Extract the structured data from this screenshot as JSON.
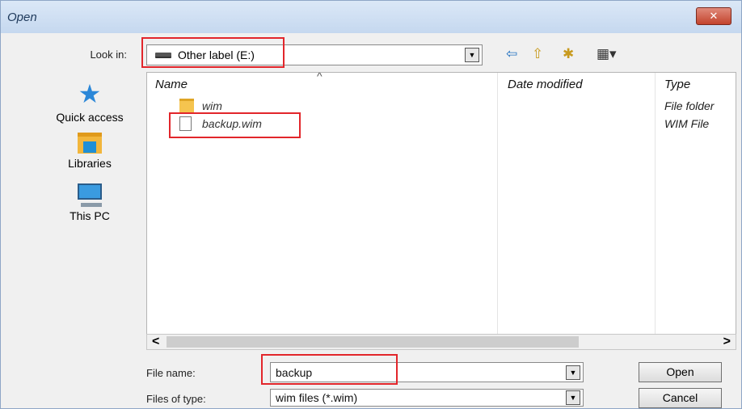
{
  "window": {
    "title": "Open",
    "close_symbol": "✕"
  },
  "look_in": {
    "label": "Look in:",
    "value": "Other label (E:)"
  },
  "toolbar": {
    "back_glyph": "⇦",
    "up_glyph": "⇧",
    "new_folder_glyph": "✱",
    "view_glyph": "▦▾"
  },
  "places": [
    {
      "label": "Quick access",
      "icon": "quick-access-star-icon"
    },
    {
      "label": "Libraries",
      "icon": "libraries-icon"
    },
    {
      "label": "This PC",
      "icon": "this-pc-icon"
    }
  ],
  "columns": {
    "name": "Name",
    "date_modified": "Date modified",
    "type": "Type",
    "sort_caret": "^"
  },
  "files": [
    {
      "name": "wim",
      "type": "File folder",
      "icon": "folder-icon"
    },
    {
      "name": "backup.wim",
      "type": "WIM File",
      "icon": "file-icon"
    }
  ],
  "scroll": {
    "left": "<",
    "right": ">"
  },
  "file_name": {
    "label": "File name:",
    "value": "backup"
  },
  "files_of_type": {
    "label": "Files of type:",
    "value": "wim files (*.wim)"
  },
  "buttons": {
    "open": "Open",
    "cancel": "Cancel"
  },
  "colors": {
    "highlight": "#e2262b",
    "accent": "#2b87d8"
  }
}
